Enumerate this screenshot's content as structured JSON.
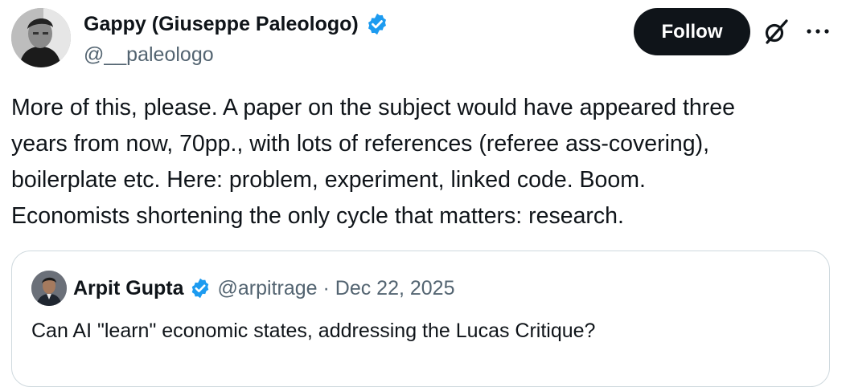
{
  "author": {
    "name": "Gappy (Giuseppe Paleologo)",
    "handle": "@__paleologo",
    "verified": true
  },
  "actions": {
    "follow_label": "Follow",
    "grok_icon": "grok-slash-icon",
    "more_icon": "more-dots-icon"
  },
  "tweet": {
    "text": "More of this, please. A paper on the subject would have appeared three\nyears from now, 70pp., with lots of references (referee ass-covering),\nboilerplate etc. Here: problem, experiment, linked code. Boom.\nEconomists shortening the only cycle that matters: research."
  },
  "quoted": {
    "name": "Arpit Gupta",
    "verified": true,
    "meta": "@arpitrage · Dec 22, 2025",
    "text": "Can AI \"learn\" economic states, addressing the Lucas Critique?"
  },
  "colors": {
    "verified_blue": "#1d9bf0",
    "text": "#0f1419",
    "secondary": "#536471",
    "border": "#cfd9de",
    "button_bg": "#0f1419"
  }
}
